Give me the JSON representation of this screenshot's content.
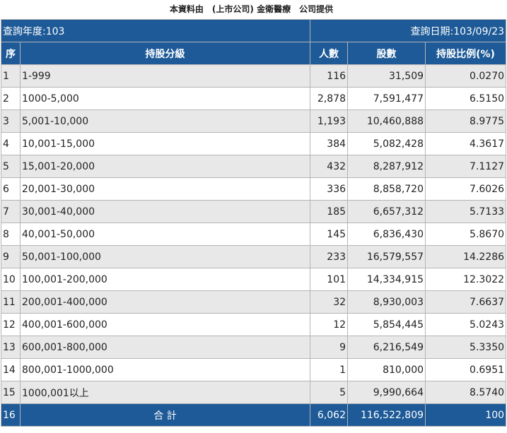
{
  "caption": "本資料由　(上市公司) 金衛醫療　公司提供",
  "info": {
    "year_label": "查詢年度:103",
    "date_label": "查詢日期:103/09/23"
  },
  "headers": {
    "seq": "序",
    "grade": "持股分級",
    "people": "人數",
    "shares": "股數",
    "ratio": "持股比例(%)"
  },
  "rows": [
    {
      "seq": "1",
      "grade": "1-999",
      "people": "116",
      "shares": "31,509",
      "ratio": "0.0270"
    },
    {
      "seq": "2",
      "grade": "1000-5,000",
      "people": "2,878",
      "shares": "7,591,477",
      "ratio": "6.5150"
    },
    {
      "seq": "3",
      "grade": "5,001-10,000",
      "people": "1,193",
      "shares": "10,460,888",
      "ratio": "8.9775"
    },
    {
      "seq": "4",
      "grade": "10,001-15,000",
      "people": "384",
      "shares": "5,082,428",
      "ratio": "4.3617"
    },
    {
      "seq": "5",
      "grade": "15,001-20,000",
      "people": "432",
      "shares": "8,287,912",
      "ratio": "7.1127"
    },
    {
      "seq": "6",
      "grade": "20,001-30,000",
      "people": "336",
      "shares": "8,858,720",
      "ratio": "7.6026"
    },
    {
      "seq": "7",
      "grade": "30,001-40,000",
      "people": "185",
      "shares": "6,657,312",
      "ratio": "5.7133"
    },
    {
      "seq": "8",
      "grade": "40,001-50,000",
      "people": "145",
      "shares": "6,836,430",
      "ratio": "5.8670"
    },
    {
      "seq": "9",
      "grade": "50,001-100,000",
      "people": "233",
      "shares": "16,579,557",
      "ratio": "14.2286"
    },
    {
      "seq": "10",
      "grade": "100,001-200,000",
      "people": "101",
      "shares": "14,334,915",
      "ratio": "12.3022"
    },
    {
      "seq": "11",
      "grade": "200,001-400,000",
      "people": "32",
      "shares": "8,930,003",
      "ratio": "7.6637"
    },
    {
      "seq": "12",
      "grade": "400,001-600,000",
      "people": "12",
      "shares": "5,854,445",
      "ratio": "5.0243"
    },
    {
      "seq": "13",
      "grade": "600,001-800,000",
      "people": "9",
      "shares": "6,216,549",
      "ratio": "5.3350"
    },
    {
      "seq": "14",
      "grade": "800,001-1000,000",
      "people": "1",
      "shares": "810,000",
      "ratio": "0.6951"
    },
    {
      "seq": "15",
      "grade": "1000,001以上",
      "people": "5",
      "shares": "9,990,664",
      "ratio": "8.5740"
    }
  ],
  "total": {
    "seq": "16",
    "label": "合 計",
    "people": "6,062",
    "shares": "116,522,809",
    "ratio": "100"
  },
  "colors": {
    "header_bg": "#1d5a97",
    "odd_row_bg": "#e8e8e8",
    "even_row_bg": "#ffffff"
  }
}
